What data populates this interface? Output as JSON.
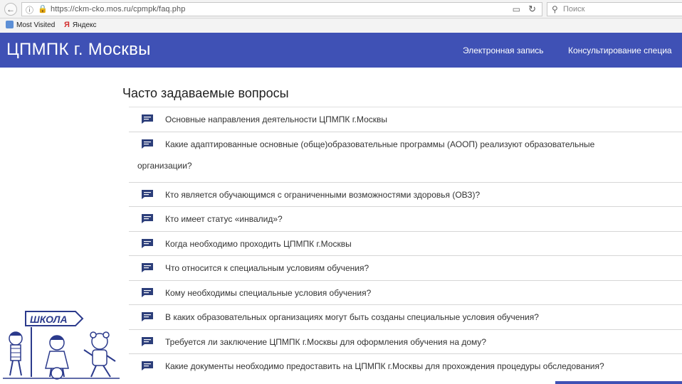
{
  "browser": {
    "url": "https://ckm-cko.mos.ru/cpmpk/faq.php",
    "search_placeholder": "Поиск",
    "bookmarks": [
      {
        "label": "Most Visited"
      },
      {
        "label": "Яндекс"
      }
    ]
  },
  "site": {
    "title": "ЦПМПК г. Москвы",
    "nav": [
      "Электронная запись",
      "Консультирование специа"
    ]
  },
  "page": {
    "heading": "Часто задаваемые вопросы"
  },
  "faq": [
    "Основные направления деятельности ЦПМПК г.Москвы",
    "Какие адаптированные основные (обще)образовательные программы (АООП) реализуют образовательные",
    "организации?",
    "Кто является обучающимся с ограниченными возможностями здоровья (ОВЗ)?",
    "Кто имеет статус «инвалид»?",
    "Когда необходимо проходить ЦПМПК г.Москвы",
    "Что относится к специальным условиям обучения?",
    "Кому необходимы специальные условия обучения?",
    "В каких образовательных организациях могут быть созданы специальные условия обучения?",
    "Требуется ли заключение ЦПМПК г.Москвы для оформления обучения на дому?",
    "Какие документы необходимо предоставить на ЦПМПК г.Москвы для прохождения процедуры обследования?"
  ],
  "illustration": {
    "sign_text": "ШКОЛА"
  },
  "colors": {
    "header": "#3f51b5",
    "faq_icon": "#2c3e7a"
  },
  "icons": {
    "faq": "chat-bubble-icon",
    "back": "back-arrow-icon",
    "reload": "reload-icon",
    "search": "search-icon"
  }
}
